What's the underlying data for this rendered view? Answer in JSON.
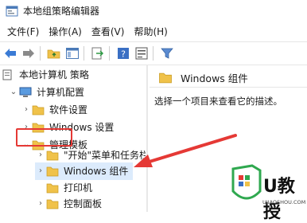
{
  "window": {
    "title": "本地组策略编辑器"
  },
  "menu": [
    "文件(F)",
    "操作(A)",
    "查看(V)",
    "帮助(H)"
  ],
  "toolbar": {
    "buttons": [
      "back-icon",
      "forward-icon",
      "up-folder-icon",
      "show-hide-tree-icon",
      "export-list-icon",
      "help-icon",
      "properties-icon",
      "filter-icon"
    ]
  },
  "tree": {
    "items": [
      {
        "label": "本地计算机 策略"
      },
      {
        "label": "计算机配置"
      },
      {
        "label": "软件设置"
      },
      {
        "label": "Windows 设置"
      },
      {
        "label": "管理模板"
      },
      {
        "label": "\"开始\"菜单和任务栏"
      },
      {
        "label": "Windows 组件"
      },
      {
        "label": "打印机"
      },
      {
        "label": "控制面板"
      }
    ]
  },
  "details": {
    "header": "Windows 组件",
    "description": "选择一个项目来查看它的描述。"
  },
  "watermark": {
    "brand": "U教授",
    "url": "UJIAOSHOU.COM"
  },
  "colors": {
    "highlight": "#e53935",
    "folder": "#f0c24a",
    "selection": "#dcebfc",
    "watermark_green": "#2fa84f"
  }
}
